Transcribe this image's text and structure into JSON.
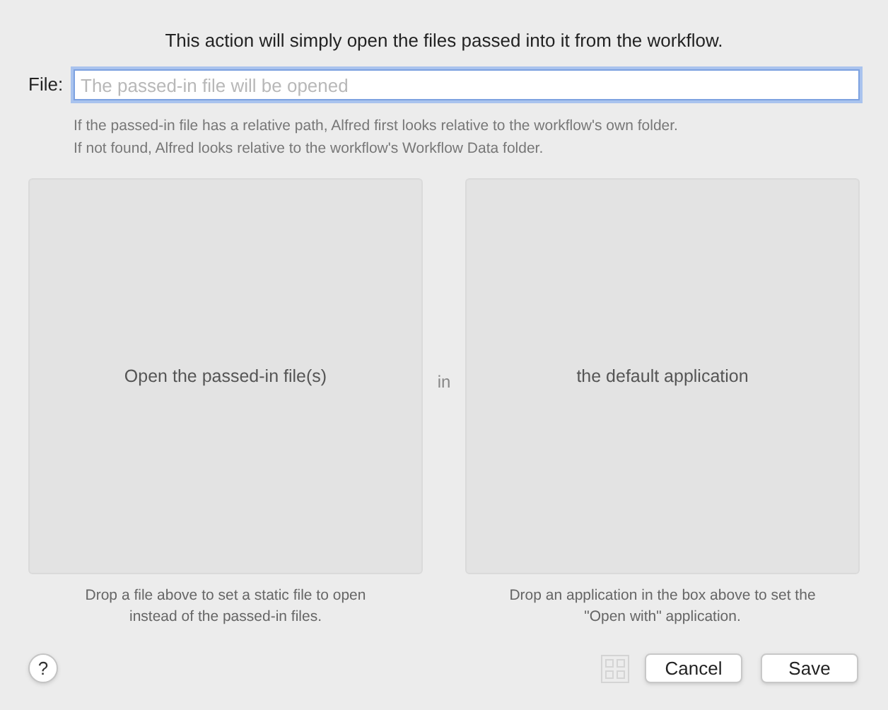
{
  "header": "This action will simply open the files passed into it from the workflow.",
  "file_field": {
    "label": "File:",
    "placeholder": "The passed-in file will be opened",
    "focused": true
  },
  "hint_lines": [
    "If the passed-in file has a relative path, Alfred first looks relative to the workflow's own folder.",
    "If not found, Alfred looks relative to the workflow's Workflow Data folder."
  ],
  "drop_zones": [
    {
      "label": "Open the passed-in file(s)",
      "caption": [
        "Drop a file above to set a static file to open",
        "instead of the passed-in files."
      ]
    },
    {
      "label": "the default application",
      "caption": [
        "Drop an application in the box above to set the",
        "\"Open with\" application."
      ]
    }
  ],
  "connector": "in",
  "help": "?",
  "buttons": [
    "Cancel",
    "Save"
  ]
}
